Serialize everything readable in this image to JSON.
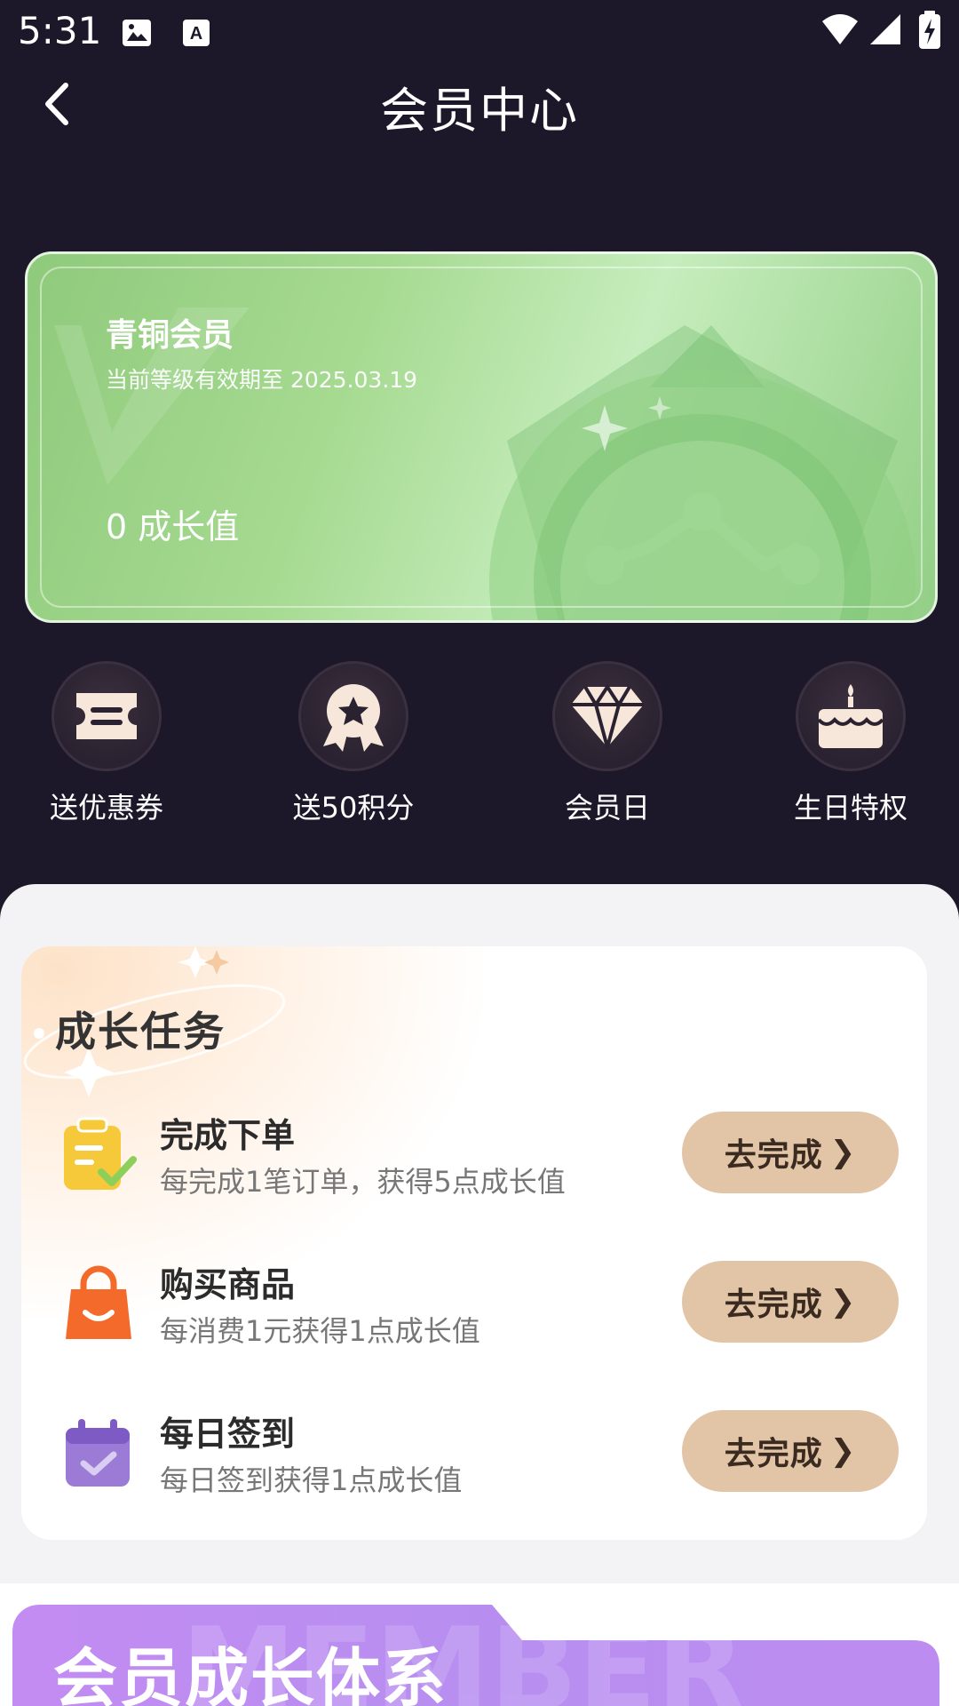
{
  "status_bar": {
    "time": "5:31"
  },
  "header": {
    "title": "会员中心"
  },
  "member_card": {
    "level_name": "青铜会员",
    "validity": "当前等级有效期至 2025.03.19",
    "growth_value": "0",
    "growth_label": "成长值"
  },
  "benefits": [
    {
      "label": "送优惠券",
      "icon": "ticket-icon"
    },
    {
      "label": "送50积分",
      "icon": "star-medal-icon"
    },
    {
      "label": "会员日",
      "icon": "diamond-icon"
    },
    {
      "label": "生日特权",
      "icon": "cake-icon"
    }
  ],
  "tasks": {
    "title": "成长任务",
    "items": [
      {
        "name": "完成下单",
        "desc": "每完成1笔订单，获得5点成长值",
        "button": "去完成",
        "icon": "order-check-icon",
        "color": "#f6c93b"
      },
      {
        "name": "购买商品",
        "desc": "每消费1元获得1点成长值",
        "button": "去完成",
        "icon": "shopping-bag-icon",
        "color": "#f36a2a"
      },
      {
        "name": "每日签到",
        "desc": "每日签到获得1点成长值",
        "button": "去完成",
        "icon": "calendar-check-icon",
        "color": "#9b7bd6"
      }
    ]
  },
  "growth_system": {
    "title": "会员成长体系",
    "watermark": "MEMBER"
  },
  "colors": {
    "background": "#1c1829",
    "card_green": "#a6da91",
    "button": "#e2c4a6",
    "banner_purple": "#b98cf0"
  }
}
